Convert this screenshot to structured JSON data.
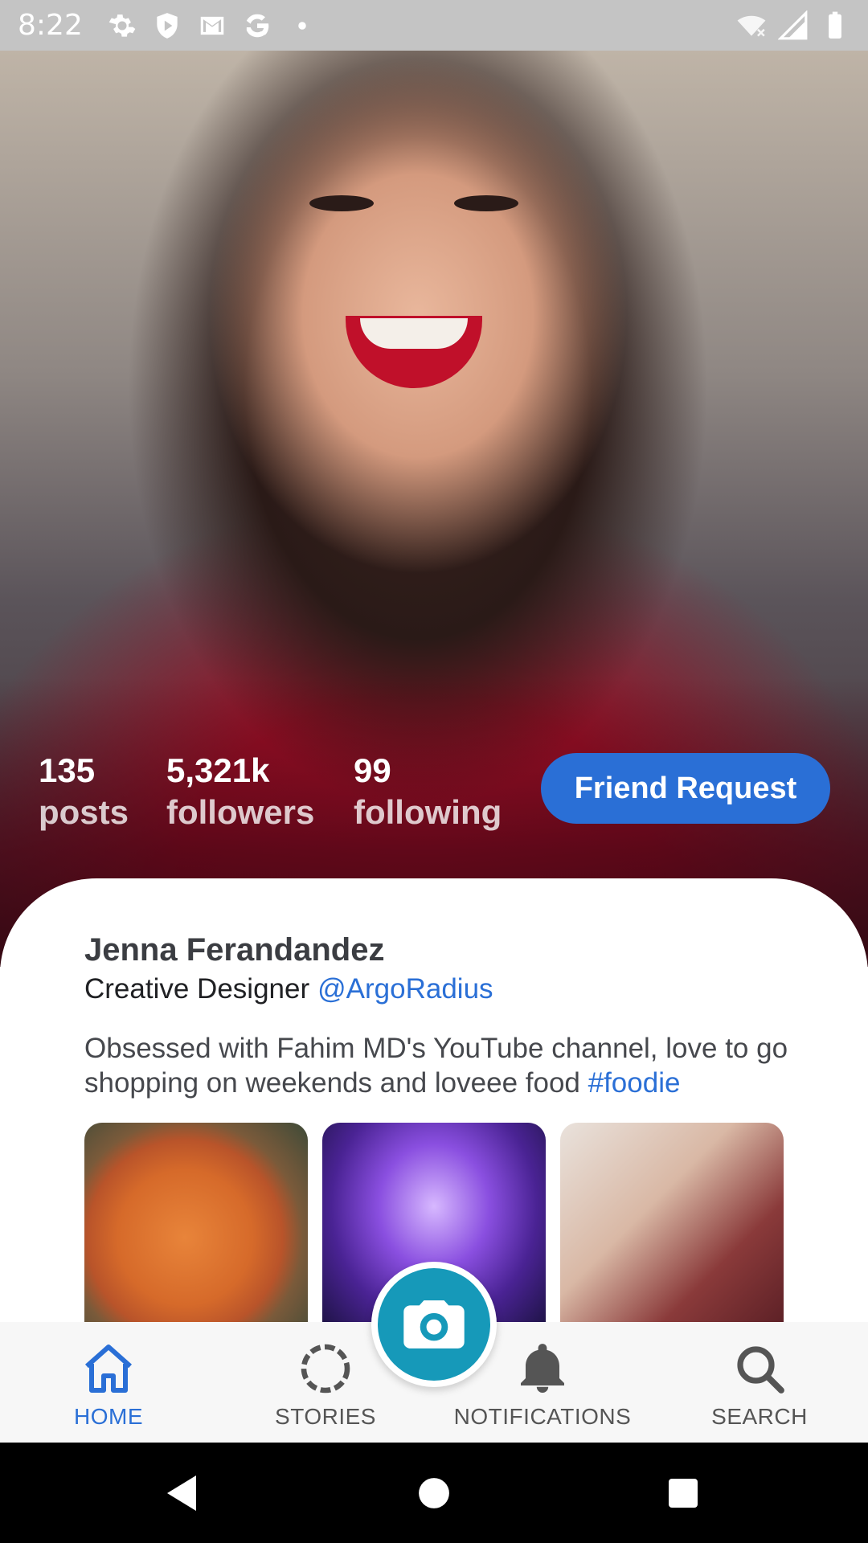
{
  "status_bar": {
    "time": "8:22",
    "icons_left": [
      "gear-icon",
      "shield-icon",
      "gmail-icon",
      "google-icon",
      "dot-icon"
    ],
    "icons_right": [
      "wifi-off-icon",
      "signal-icon",
      "battery-icon"
    ]
  },
  "profile": {
    "stats": [
      {
        "value": "135",
        "label": "posts"
      },
      {
        "value": "5,321k",
        "label": "followers"
      },
      {
        "value": "99",
        "label": "following"
      }
    ],
    "friend_request_label": "Friend Request",
    "name": "Jenna Ferandandez",
    "role": "Creative Designer",
    "handle": "@ArgoRadius",
    "bio_text": "Obsessed with Fahim MD's YouTube channel, love to go shopping on weekends and loveee food ",
    "bio_hashtag": "#foodie",
    "accent_color": "#2a6fd6"
  },
  "bottom_nav": {
    "items": [
      {
        "label": "HOME",
        "icon": "home-icon",
        "active": true
      },
      {
        "label": "STORIES",
        "icon": "stories-icon",
        "active": false
      },
      {
        "label": "NOTIFICATIONS",
        "icon": "bell-icon",
        "active": false
      },
      {
        "label": "SEARCH",
        "icon": "search-icon",
        "active": false
      }
    ],
    "fab_icon": "camera-icon",
    "fab_color": "#1699b9"
  },
  "system_nav": [
    "back-icon",
    "home-circle-icon",
    "recents-icon"
  ]
}
